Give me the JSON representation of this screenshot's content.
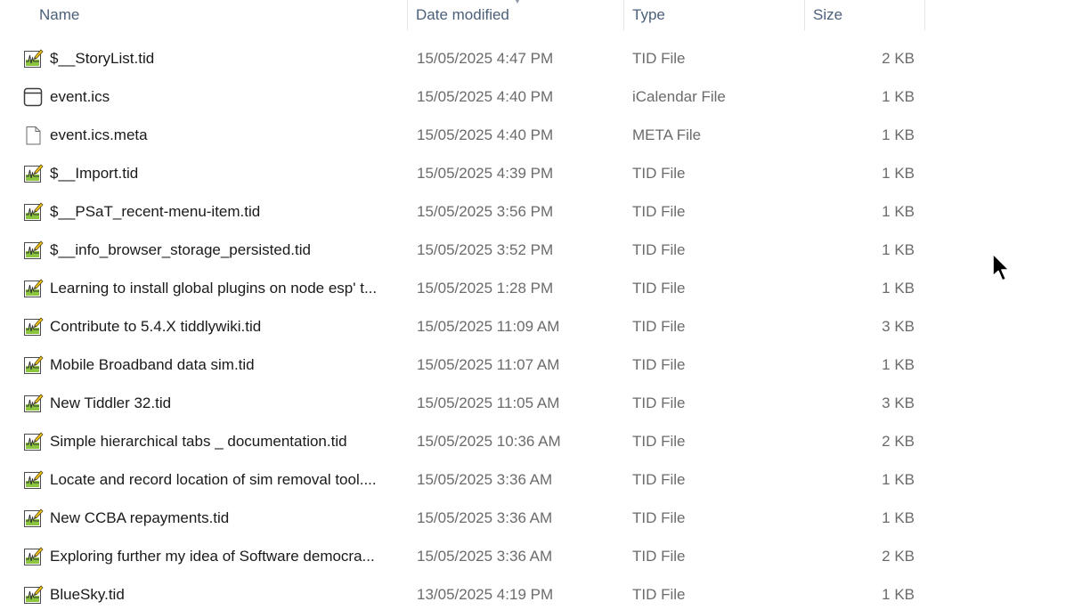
{
  "columns": {
    "name": "Name",
    "date": "Date modified",
    "type": "Type",
    "size": "Size"
  },
  "files": [
    {
      "name": "$__StoryList.tid",
      "date": "15/05/2025 4:47 PM",
      "type": "TID File",
      "size": "2 KB",
      "icon": "tid-file-icon"
    },
    {
      "name": "event.ics",
      "date": "15/05/2025 4:40 PM",
      "type": "iCalendar File",
      "size": "1 KB",
      "icon": "calendar-file-icon"
    },
    {
      "name": "event.ics.meta",
      "date": "15/05/2025 4:40 PM",
      "type": "META File",
      "size": "1 KB",
      "icon": "generic-file-icon"
    },
    {
      "name": "$__Import.tid",
      "date": "15/05/2025 4:39 PM",
      "type": "TID File",
      "size": "1 KB",
      "icon": "tid-file-icon"
    },
    {
      "name": "$__PSaT_recent-menu-item.tid",
      "date": "15/05/2025 3:56 PM",
      "type": "TID File",
      "size": "1 KB",
      "icon": "tid-file-icon"
    },
    {
      "name": "$__info_browser_storage_persisted.tid",
      "date": "15/05/2025 3:52 PM",
      "type": "TID File",
      "size": "1 KB",
      "icon": "tid-file-icon"
    },
    {
      "name": "Learning to install global plugins on node esp' t...",
      "date": "15/05/2025 1:28 PM",
      "type": "TID File",
      "size": "1 KB",
      "icon": "tid-file-icon"
    },
    {
      "name": "Contribute to 5.4.X tiddlywiki.tid",
      "date": "15/05/2025 11:09 AM",
      "type": "TID File",
      "size": "3 KB",
      "icon": "tid-file-icon"
    },
    {
      "name": "Mobile Broadband data sim.tid",
      "date": "15/05/2025 11:07 AM",
      "type": "TID File",
      "size": "1 KB",
      "icon": "tid-file-icon"
    },
    {
      "name": "New Tiddler 32.tid",
      "date": "15/05/2025 11:05 AM",
      "type": "TID File",
      "size": "3 KB",
      "icon": "tid-file-icon"
    },
    {
      "name": "Simple hierarchical tabs _ documentation.tid",
      "date": "15/05/2025 10:36 AM",
      "type": "TID File",
      "size": "2 KB",
      "icon": "tid-file-icon"
    },
    {
      "name": "Locate and record location of sim removal tool....",
      "date": "15/05/2025 3:36 AM",
      "type": "TID File",
      "size": "1 KB",
      "icon": "tid-file-icon"
    },
    {
      "name": "New CCBA repayments.tid",
      "date": "15/05/2025 3:36 AM",
      "type": "TID File",
      "size": "1 KB",
      "icon": "tid-file-icon"
    },
    {
      "name": "Exploring further my idea of Software democra...",
      "date": "15/05/2025 3:36 AM",
      "type": "TID File",
      "size": "2 KB",
      "icon": "tid-file-icon"
    },
    {
      "name": "BlueSky.tid",
      "date": "13/05/2025 4:19 PM",
      "type": "TID File",
      "size": "1 KB",
      "icon": "tid-file-icon"
    }
  ],
  "colors": {
    "header_text": "#4c607a",
    "secondary_text": "#6b6b6b",
    "primary_text": "#1a1a1a",
    "tid_icon_green": "#8cc63f"
  }
}
